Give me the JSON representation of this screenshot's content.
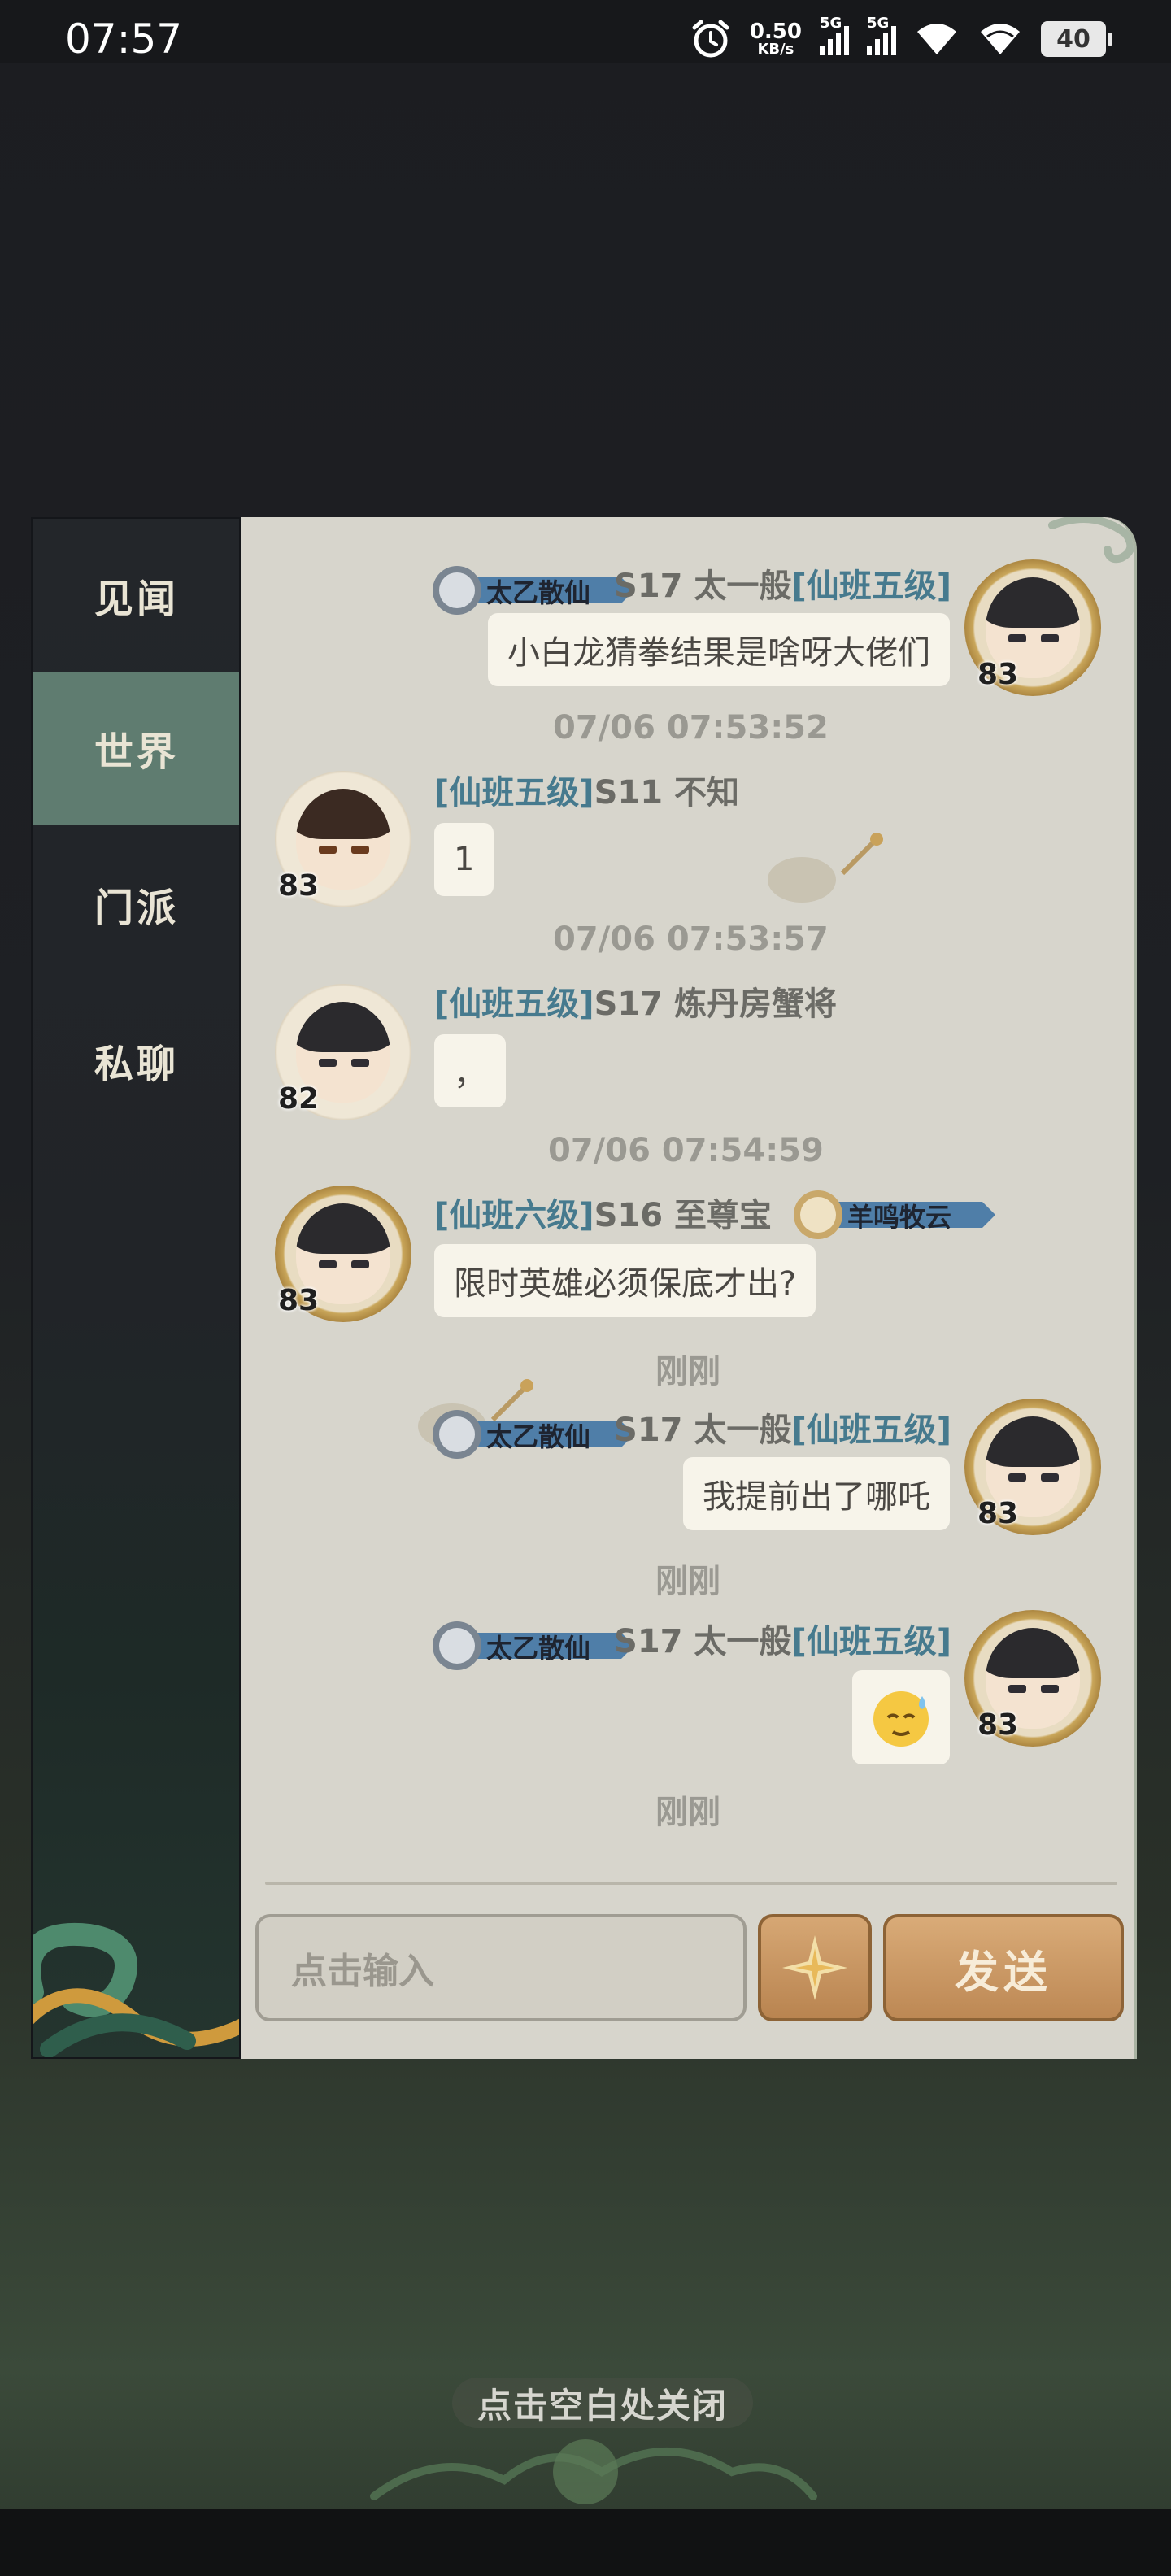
{
  "status_bar": {
    "time": "07:57",
    "net_rate": "0.50",
    "net_rate_unit": "KB/s",
    "sim1": "5G",
    "sim2": "5G",
    "battery": "40"
  },
  "tabs": [
    {
      "label": "见闻",
      "active": false
    },
    {
      "label": "世界",
      "active": true
    },
    {
      "label": "门派",
      "active": false
    },
    {
      "label": "私聊",
      "active": false
    }
  ],
  "messages": [
    {
      "side": "right",
      "badge": "太乙散仙",
      "name": "S17 太一般",
      "rank": "[仙班五级]",
      "text": "小白龙猜拳结果是啥呀大佬们",
      "level": "83"
    },
    {
      "timestamp": "07/06 07:53:52"
    },
    {
      "side": "left",
      "rank": "[仙班五级]",
      "name": "S11 不知",
      "text": "1",
      "level": "83"
    },
    {
      "timestamp": "07/06 07:53:57"
    },
    {
      "side": "left",
      "rank": "[仙班五级]",
      "name": "S17 炼丹房蟹将",
      "text": "，",
      "level": "82"
    },
    {
      "timestamp": "07/06 07:54:59"
    },
    {
      "side": "left",
      "rank": "[仙班六级]",
      "name": "S16 至尊宝",
      "badge": "羊鸣牧云",
      "text": "限时英雄必须保底才出?",
      "level": "83"
    },
    {
      "timestamp": "刚刚"
    },
    {
      "side": "right",
      "badge": "太乙散仙",
      "name": "S17 太一般",
      "rank": "[仙班五级]",
      "text": "我提前出了哪吒",
      "level": "83"
    },
    {
      "timestamp": "刚刚"
    },
    {
      "side": "right",
      "badge": "太乙散仙",
      "name": "S17 太一般",
      "rank": "[仙班五级]",
      "emoji": "sweat-smile-emoji",
      "level": "83"
    },
    {
      "timestamp": "刚刚"
    }
  ],
  "input": {
    "placeholder": "点击输入"
  },
  "send_label": "发送",
  "emoji_button_icon": "flower-icon",
  "close_hint": "点击空白处关闭"
}
